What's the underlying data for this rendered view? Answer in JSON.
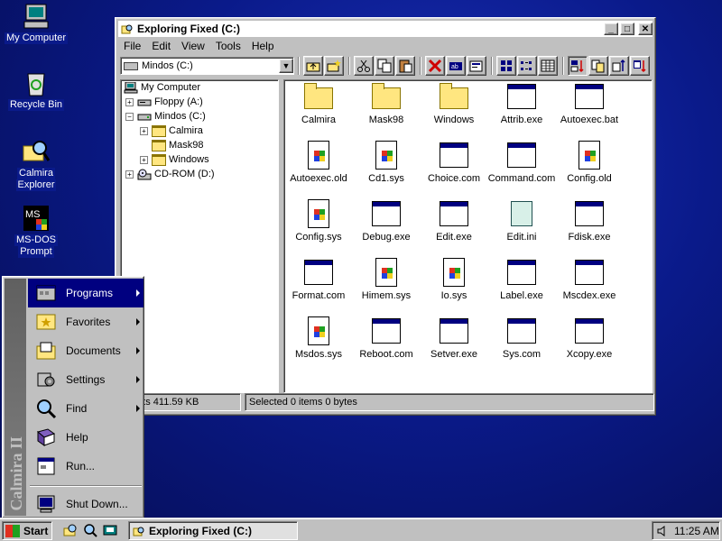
{
  "desktop": {
    "icons": [
      {
        "label_line1": "My Computer",
        "label_line2": "",
        "icon": "computer-icon"
      },
      {
        "label_line1": "Recycle Bin",
        "label_line2": "",
        "icon": "recycle-bin-icon"
      },
      {
        "label_line1": "Calmira",
        "label_line2": "Explorer",
        "icon": "explorer-icon"
      },
      {
        "label_line1": "MS-DOS",
        "label_line2": "Prompt",
        "icon": "msdos-icon"
      }
    ]
  },
  "window": {
    "title": "Exploring Fixed (C:)",
    "menu": [
      "File",
      "Edit",
      "View",
      "Tools",
      "Help"
    ],
    "drive_combo": "Mindos (C:)",
    "tree": [
      {
        "label": "My Computer",
        "expander": ""
      },
      {
        "label": "Floppy (A:)",
        "expander": "+"
      },
      {
        "label": "Mindos (C:)",
        "expander": "−"
      },
      {
        "label": "Calmira",
        "expander": "+"
      },
      {
        "label": "Mask98",
        "expander": ""
      },
      {
        "label": "Windows",
        "expander": "+"
      },
      {
        "label": "CD-ROM (D:)",
        "expander": "+"
      }
    ],
    "files": [
      {
        "name": "Calmira",
        "type": "folder"
      },
      {
        "name": "Mask98",
        "type": "folder"
      },
      {
        "name": "Windows",
        "type": "folder"
      },
      {
        "name": "Attrib.exe",
        "type": "app"
      },
      {
        "name": "Autoexec.bat",
        "type": "app"
      },
      {
        "name": "Autoexec.old",
        "type": "doc"
      },
      {
        "name": "Cd1.sys",
        "type": "doc"
      },
      {
        "name": "Choice.com",
        "type": "app"
      },
      {
        "name": "Command.com",
        "type": "app"
      },
      {
        "name": "Config.old",
        "type": "doc"
      },
      {
        "name": "Config.sys",
        "type": "doc"
      },
      {
        "name": "Debug.exe",
        "type": "app"
      },
      {
        "name": "Edit.exe",
        "type": "app"
      },
      {
        "name": "Edit.ini",
        "type": "notepad"
      },
      {
        "name": "Fdisk.exe",
        "type": "app"
      },
      {
        "name": "Format.com",
        "type": "app"
      },
      {
        "name": "Himem.sys",
        "type": "doc"
      },
      {
        "name": "Io.sys",
        "type": "doc"
      },
      {
        "name": "Label.exe",
        "type": "app"
      },
      {
        "name": "Mscdex.exe",
        "type": "app"
      },
      {
        "name": "Msdos.sys",
        "type": "doc"
      },
      {
        "name": "Reboot.com",
        "type": "app"
      },
      {
        "name": "Setver.exe",
        "type": "app"
      },
      {
        "name": "Sys.com",
        "type": "app"
      },
      {
        "name": "Xcopy.exe",
        "type": "app"
      }
    ],
    "status_left": "bjects  411.59 KB",
    "status_right": "Selected 0 items  0 bytes"
  },
  "start_menu": {
    "band_text": "Calmira II",
    "items": [
      {
        "label": "Programs",
        "submenu": true,
        "icon": "programs-icon"
      },
      {
        "label": "Favorites",
        "submenu": true,
        "icon": "favorites-icon"
      },
      {
        "label": "Documents",
        "submenu": true,
        "icon": "documents-icon"
      },
      {
        "label": "Settings",
        "submenu": true,
        "icon": "settings-icon"
      },
      {
        "label": "Find",
        "submenu": true,
        "icon": "find-icon"
      },
      {
        "label": "Help",
        "submenu": false,
        "icon": "help-icon"
      },
      {
        "label": "Run...",
        "submenu": false,
        "icon": "run-icon"
      },
      {
        "label": "Shut Down...",
        "submenu": false,
        "icon": "shutdown-icon"
      }
    ]
  },
  "taskbar": {
    "start_label": "Start",
    "task_label": "Exploring Fixed (C:)",
    "clock": "11:25 AM"
  },
  "colors": {
    "desktop": "#0a1a8a",
    "highlight": "#000080",
    "face": "#c0c0c0"
  }
}
